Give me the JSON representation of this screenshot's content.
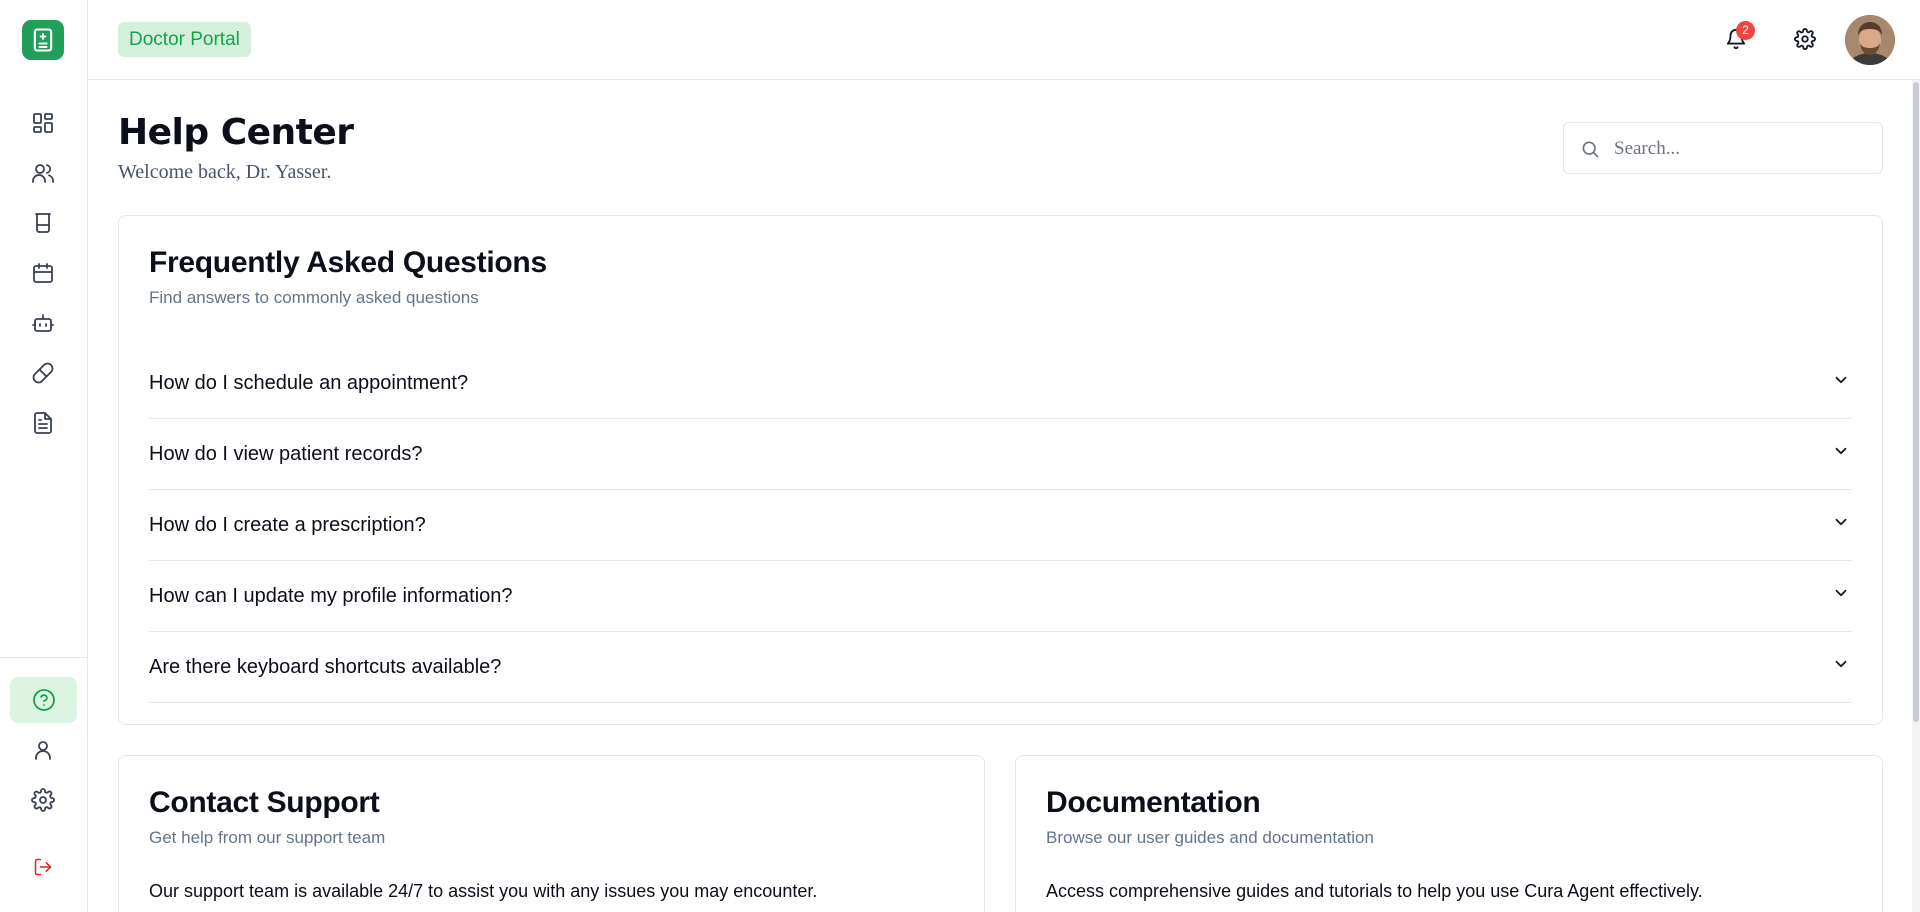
{
  "topbar": {
    "portal_label": "Doctor Portal",
    "notification_count": "2"
  },
  "sidebar": {
    "items": [
      {
        "name": "dashboard",
        "icon": "grid-icon"
      },
      {
        "name": "patients",
        "icon": "users-icon"
      },
      {
        "name": "lab",
        "icon": "beaker-icon"
      },
      {
        "name": "appointments",
        "icon": "calendar-icon"
      },
      {
        "name": "agent",
        "icon": "bot-icon"
      },
      {
        "name": "prescriptions",
        "icon": "pill-icon"
      },
      {
        "name": "reports",
        "icon": "document-icon"
      }
    ],
    "bottom_items": [
      {
        "name": "help",
        "icon": "help-circle-icon",
        "active": true
      },
      {
        "name": "profile",
        "icon": "user-icon"
      },
      {
        "name": "settings",
        "icon": "gear-icon"
      },
      {
        "name": "logout",
        "icon": "logout-icon"
      }
    ]
  },
  "header": {
    "title": "Help Center",
    "subtitle": "Welcome back, Dr. Yasser."
  },
  "search": {
    "placeholder": "Search..."
  },
  "faq": {
    "title": "Frequently Asked Questions",
    "description": "Find answers to commonly asked questions",
    "items": [
      {
        "question": "How do I schedule an appointment?"
      },
      {
        "question": "How do I view patient records?"
      },
      {
        "question": "How do I create a prescription?"
      },
      {
        "question": "How can I update my profile information?"
      },
      {
        "question": "Are there keyboard shortcuts available?"
      }
    ]
  },
  "contact": {
    "title": "Contact Support",
    "description": "Get help from our support team",
    "body": "Our support team is available 24/7 to assist you with any issues you may encounter."
  },
  "documentation": {
    "title": "Documentation",
    "description": "Browse our user guides and documentation",
    "body": "Access comprehensive guides and tutorials to help you use Cura Agent effectively."
  },
  "colors": {
    "brand": "#22a05b",
    "brand_light": "#d4f0dc",
    "notification": "#ef4444",
    "logout": "#dc2626"
  }
}
